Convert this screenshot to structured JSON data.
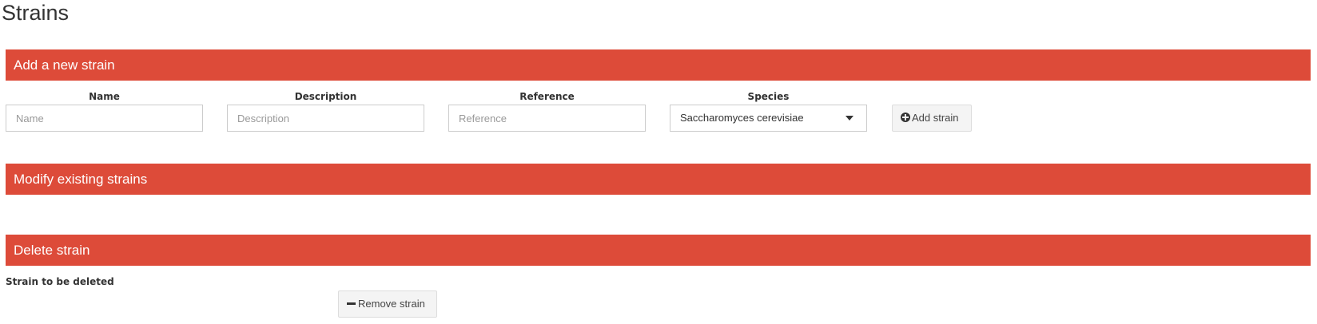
{
  "page": {
    "title": "Strains"
  },
  "add_section": {
    "header": "Add a new strain",
    "name_label": "Name",
    "name_placeholder": "Name",
    "name_value": "",
    "description_label": "Description",
    "description_placeholder": "Description",
    "description_value": "",
    "reference_label": "Reference",
    "reference_placeholder": "Reference",
    "reference_value": "",
    "species_label": "Species",
    "species_selected": "Saccharomyces cerevisiae",
    "add_button_label": "Add strain",
    "add_button_icon": "plus-circle-icon"
  },
  "modify_section": {
    "header": "Modify existing strains"
  },
  "delete_section": {
    "header": "Delete strain",
    "select_label": "Strain to be deleted",
    "remove_button_label": "Remove strain",
    "remove_button_icon": "minus-icon"
  },
  "colors": {
    "panel_header": "#dd4b39",
    "button_bg": "#f4f4f4"
  }
}
